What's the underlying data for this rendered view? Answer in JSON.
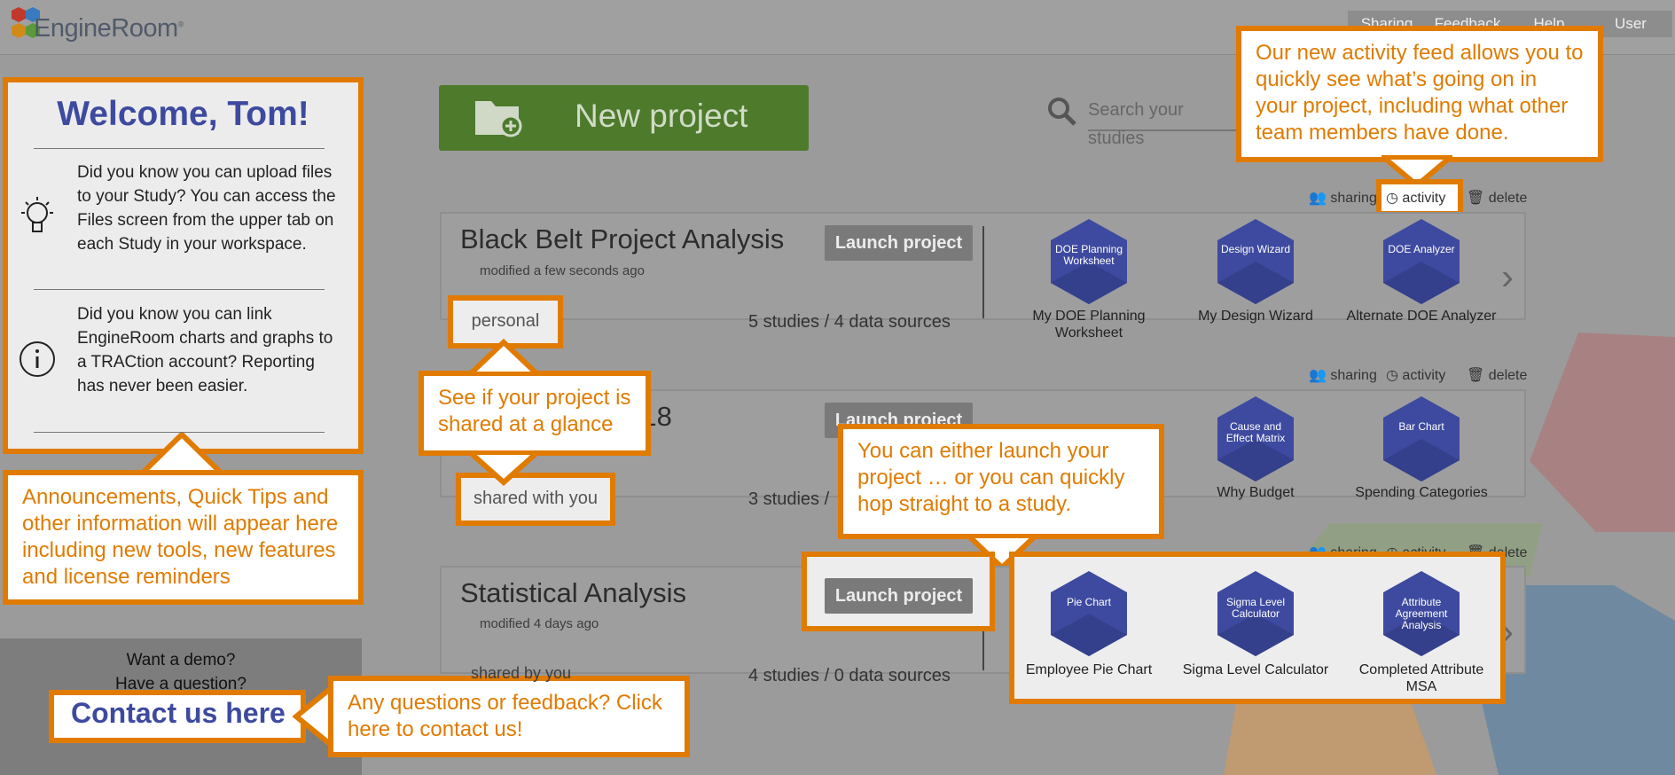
{
  "app": {
    "logo": "EngineRoom",
    "nav": [
      "Sharing",
      "Feedback",
      "Help",
      "User"
    ]
  },
  "welcome": {
    "title": "Welcome, Tom!",
    "tips": [
      "Did you know you can upload files to your Study? You can access the Files screen from the upper tab on each Study in your workspace.",
      "Did you know you can link EngineRoom charts and graphs to a TRACtion account? Reporting has never been easier."
    ]
  },
  "demo": {
    "line1": "Want a demo?",
    "line2": "Have a question?",
    "contact": "Contact us here"
  },
  "toolbar": {
    "new_project": "New project",
    "search_placeholder": "Search your studies"
  },
  "actions": {
    "sharing": "sharing",
    "activity": "activity",
    "delete": "delete"
  },
  "projects": [
    {
      "title": "Black Belt Project Analysis",
      "modified": "modified a few seconds ago",
      "share": "personal",
      "counts": "5 studies / 4 data sources",
      "launch": "Launch project",
      "studies": [
        {
          "inner": "DOE Planning Worksheet",
          "label": "My DOE Planning Worksheet"
        },
        {
          "inner": "Design Wizard",
          "label": "My Design Wizard"
        },
        {
          "inner": "DOE Analyzer",
          "label": "Alternate DOE Analyzer"
        }
      ]
    },
    {
      "title": "...ng 2018",
      "modified": "",
      "share": "shared with you",
      "counts": "3 studies /",
      "launch": "Launch project",
      "studies": [
        {
          "inner": "",
          "label": ""
        },
        {
          "inner": "Cause and Effect Matrix",
          "label": "Why Budget"
        },
        {
          "inner": "Bar Chart",
          "label": "Spending Categories"
        }
      ]
    },
    {
      "title": "Statistical Analysis",
      "modified": "modified 4 days ago",
      "share": "shared by you",
      "counts": "4 studies / 0 data sources",
      "launch": "Launch project",
      "studies": [
        {
          "inner": "Pie Chart",
          "label": "Employee Pie Chart"
        },
        {
          "inner": "Sigma Level Calculator",
          "label": "Sigma Level Calculator"
        },
        {
          "inner": "Attribute Agreement Analysis",
          "label": "Completed Attribute MSA"
        }
      ]
    }
  ],
  "callouts": {
    "activity": "Our new activity feed allows you to quickly see what’s going on in your project, including what other team members have done.",
    "shared": "See if your project is shared at a glance",
    "launch": "You can either launch your project … or you can quickly hop straight to a study.",
    "announcements": "Announcements, Quick Tips and other information will appear here including new tools, new features and license reminders",
    "contact": "Any questions or feedback? Click here to contact us!"
  }
}
